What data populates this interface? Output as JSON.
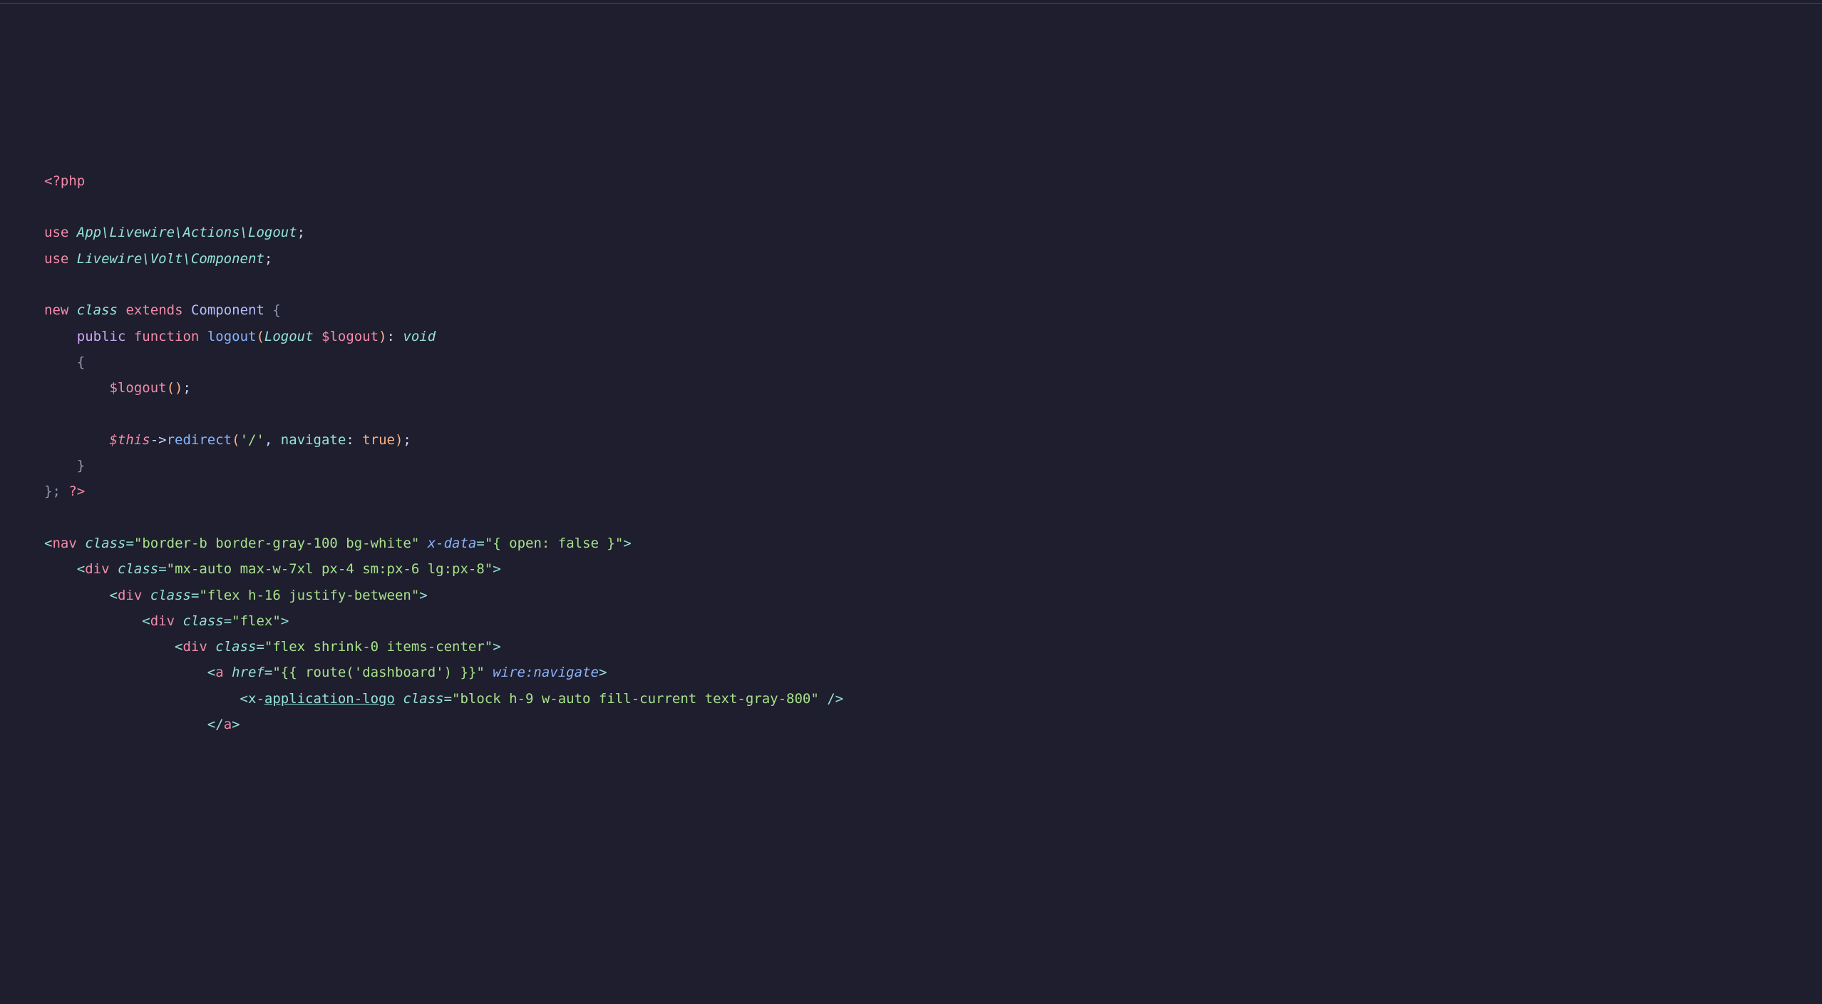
{
  "lines": {
    "l1_open": "<?php",
    "l3_use": "use",
    "l3_ns": "App\\Livewire\\Actions\\Logout",
    "l3_semi": ";",
    "l4_use": "use",
    "l4_ns": "Livewire\\Volt\\Component",
    "l4_semi": ";",
    "l6_new": "new",
    "l6_class": "class",
    "l6_extends": "extends",
    "l6_component": "Component",
    "l6_brace": " {",
    "l7_public": "public",
    "l7_function": "function",
    "l7_logout": "logout",
    "l7_paren_o": "(",
    "l7_type": "Logout",
    "l7_var": " $logout",
    "l7_paren_c": ")",
    "l7_colon": ": ",
    "l7_void": "void",
    "l8_brace": "{",
    "l9_var": "$logout",
    "l9_paren_o": "(",
    "l9_paren_c": ")",
    "l9_semi": ";",
    "l11_this": "$this",
    "l11_arrow": "->",
    "l11_redirect": "redirect",
    "l11_paren_o": "(",
    "l11_str": "'/'",
    "l11_comma": ", ",
    "l11_navigate": "navigate",
    "l11_colon2": ": ",
    "l11_true": "true",
    "l11_paren_c": ")",
    "l11_semi": ";",
    "l12_brace": "}",
    "l13_close": "}; ",
    "l13_php": "?>",
    "l15_lt": "<",
    "l15_nav": "nav",
    "l15_class": "class",
    "l15_eq": "=",
    "l15_classval": "\"border-b border-gray-100 bg-white\"",
    "l15_xdata": "x-data",
    "l15_eq2": "=",
    "l15_xdataval": "\"{ open: false }\"",
    "l15_gt": ">",
    "l16_lt": "<",
    "l16_div": "div",
    "l16_class": "class",
    "l16_eq": "=",
    "l16_classval": "\"mx-auto max-w-7xl px-4 sm:px-6 lg:px-8\"",
    "l16_gt": ">",
    "l17_lt": "<",
    "l17_div": "div",
    "l17_class": "class",
    "l17_eq": "=",
    "l17_classval": "\"flex h-16 justify-between\"",
    "l17_gt": ">",
    "l18_lt": "<",
    "l18_div": "div",
    "l18_class": "class",
    "l18_eq": "=",
    "l18_classval": "\"flex\"",
    "l18_gt": ">",
    "l19_lt": "<",
    "l19_div": "div",
    "l19_class": "class",
    "l19_eq": "=",
    "l19_classval": "\"flex shrink-0 items-center\"",
    "l19_gt": ">",
    "l20_lt": "<",
    "l20_a": "a",
    "l20_href": "href",
    "l20_eq": "=",
    "l20_hrefval": "\"{{ route('dashboard') }}\"",
    "l20_wire": "wire:navigate",
    "l20_gt": ">",
    "l21_lt": "<",
    "l21_xapp": "x-",
    "l21_applogo": "application-logo",
    "l21_class": "class",
    "l21_eq": "=",
    "l21_classval": "\"block h-9 w-auto fill-current text-gray-800\"",
    "l21_close": " />",
    "l22_lt": "<",
    "l22_slash": "/",
    "l22_a": "a",
    "l22_gt": ">"
  }
}
